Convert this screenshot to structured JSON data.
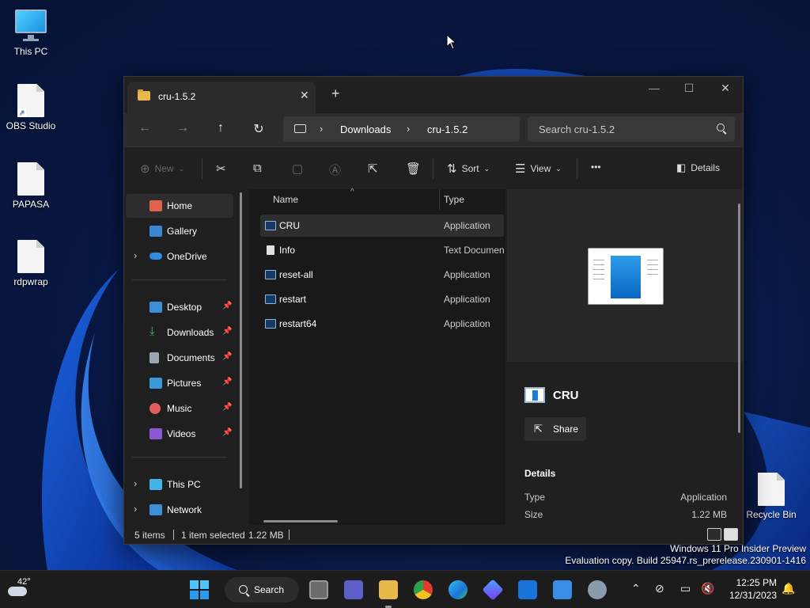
{
  "desktop": {
    "icons": [
      {
        "label": "This PC",
        "icon": "monitor-icon"
      },
      {
        "label": "OBS Studio",
        "icon": "file-shortcut-icon"
      },
      {
        "label": "PAPASA",
        "icon": "file-icon"
      },
      {
        "label": "rdpwrap",
        "icon": "file-icon"
      },
      {
        "label": "Recycle Bin",
        "icon": "file-icon"
      }
    ],
    "watermark": {
      "line1": "Windows 11 Pro Insider Preview",
      "line2": "Evaluation copy. Build 25947.rs_prerelease.230901-1416"
    }
  },
  "explorer": {
    "tab_title": "cru-1.5.2",
    "new_tab": "+",
    "window_controls": {
      "minimize": "—",
      "maximize": "☐",
      "close": "✕"
    },
    "nav": {
      "back": "←",
      "forward": "→",
      "up": "↑",
      "refresh": "↻"
    },
    "breadcrumb": [
      "Downloads",
      "cru-1.5.2"
    ],
    "search_placeholder": "Search cru-1.5.2",
    "commands": {
      "new": "New",
      "sort": "Sort",
      "view": "View",
      "more": "•••",
      "details": "Details"
    },
    "nav_pane": {
      "items": [
        {
          "label": "Home",
          "icon": "home-icon",
          "color": "#e0624b"
        },
        {
          "label": "Gallery",
          "icon": "gallery-icon",
          "color": "#3a86d4"
        },
        {
          "label": "OneDrive",
          "icon": "cloud-icon",
          "color": "#2f8ce0"
        },
        {
          "label": "Desktop",
          "icon": "desktop-icon",
          "color": "#3b8fd6"
        },
        {
          "label": "Downloads",
          "icon": "download-icon",
          "color": "#36b56b"
        },
        {
          "label": "Documents",
          "icon": "document-icon",
          "color": "#9aa6b4"
        },
        {
          "label": "Pictures",
          "icon": "pictures-icon",
          "color": "#3a9ad8"
        },
        {
          "label": "Music",
          "icon": "music-icon",
          "color": "#e25c5c"
        },
        {
          "label": "Videos",
          "icon": "videos-icon",
          "color": "#8a57d6"
        },
        {
          "label": "This PC",
          "icon": "pc-icon",
          "color": "#3fb5e8"
        },
        {
          "label": "Network",
          "icon": "network-icon",
          "color": "#3b8fd6"
        }
      ]
    },
    "columns": {
      "name": "Name",
      "type": "Type"
    },
    "files": [
      {
        "name": "CRU",
        "type": "Application",
        "icon": "app-icon"
      },
      {
        "name": "Info",
        "type": "Text Documen",
        "icon": "text-file-icon"
      },
      {
        "name": "reset-all",
        "type": "Application",
        "icon": "app-icon"
      },
      {
        "name": "restart",
        "type": "Application",
        "icon": "app-icon"
      },
      {
        "name": "restart64",
        "type": "Application",
        "icon": "app-icon"
      }
    ],
    "details_pane": {
      "title": "CRU",
      "share": "Share",
      "section": "Details",
      "rows": [
        {
          "key": "Type",
          "value": "Application"
        },
        {
          "key": "Size",
          "value": "1.22 MB"
        }
      ]
    },
    "status": {
      "items": "5 items",
      "selected": "1 item selected",
      "size": "1.22 MB"
    }
  },
  "taskbar": {
    "weather_temp": "42°",
    "search_label": "Search",
    "time": "12:25 PM",
    "date": "12/31/2023"
  }
}
